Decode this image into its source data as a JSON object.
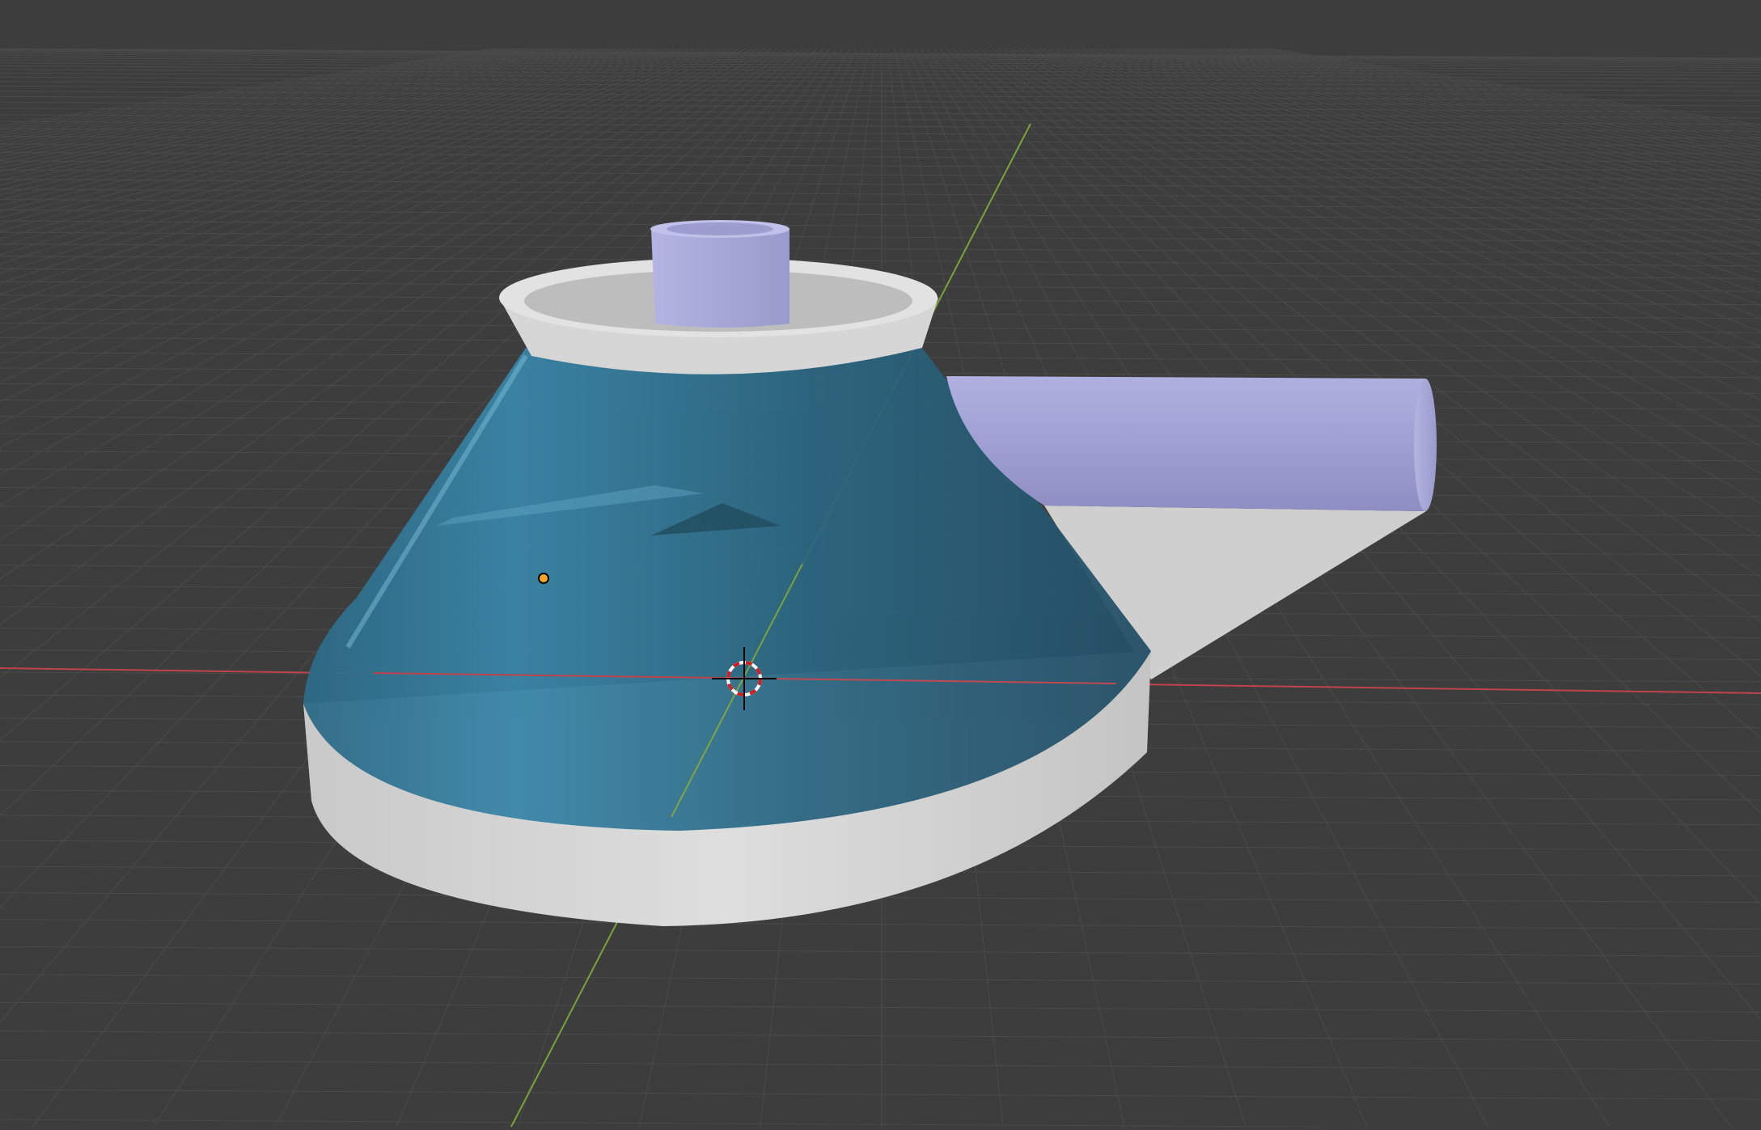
{
  "viewport": {
    "background_color": "#3d3d3d",
    "grid_color": "#4a4a4a",
    "x_axis_color": "#c0434b",
    "y_axis_color": "#7aa33a",
    "cone_color": "#2f6f8c",
    "base_color": "#d4d4d4",
    "tube_color": "#a3a3d6",
    "origin_color": "#f5a623",
    "icons": [
      "3d-cursor-icon",
      "object-origin-icon"
    ]
  }
}
